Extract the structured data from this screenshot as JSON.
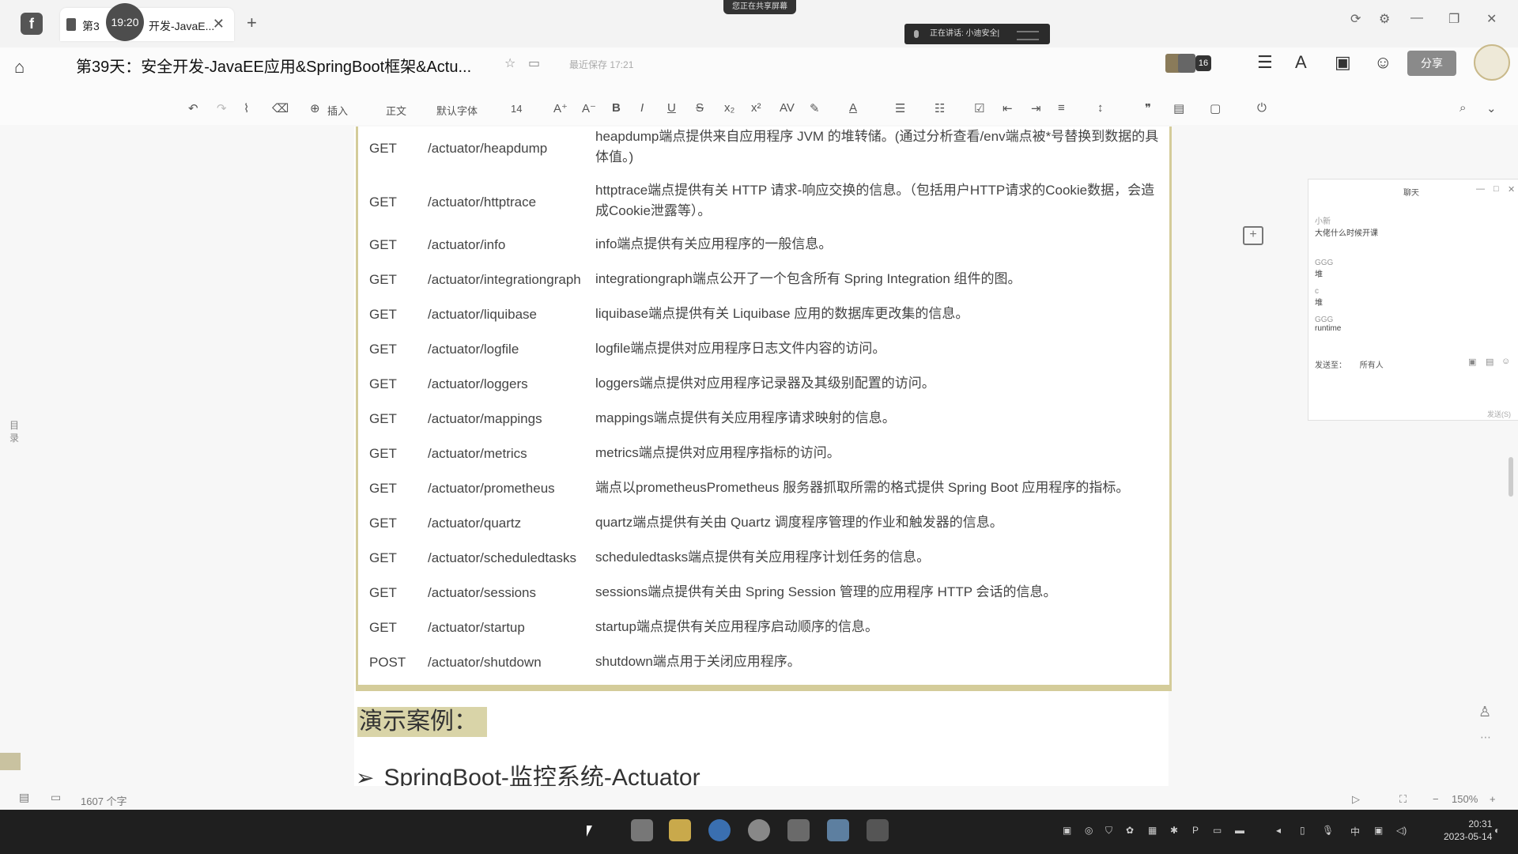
{
  "window": {
    "tab_title_left": "第3",
    "tab_title_right": "开发-JavaE...",
    "tab_close": "✕",
    "new_tab": "+",
    "timer": "19:20",
    "sharing_notice": "您正在共享屏幕",
    "voice_status": "正在讲话: 小迪安全|"
  },
  "header": {
    "doc_title": "第39天：安全开发-JavaEE应用&SpringBoot框架&Actu...",
    "save_status": "最近保存 17:21",
    "collaborators_count": "16",
    "share_label": "分享"
  },
  "toolbar": {
    "insert_label": "插入",
    "style_label": "正文",
    "font_label": "默认字体",
    "size_label": "14"
  },
  "endpoints": [
    {
      "method": "GET",
      "path": "/actuator/heapdump",
      "desc": "heapdump端点提供来自应用程序 JVM 的堆转储。(通过分析查看/env端点被*号替换到数据的具体值。)"
    },
    {
      "method": "GET",
      "path": "/actuator/httptrace",
      "desc": "httptrace端点提供有关 HTTP 请求-响应交换的信息。（包括用户HTTP请求的Cookie数据，会造成Cookie泄露等）。"
    },
    {
      "method": "GET",
      "path": "/actuator/info",
      "desc": "info端点提供有关应用程序的一般信息。"
    },
    {
      "method": "GET",
      "path": "/actuator/integrationgraph",
      "desc": "integrationgraph端点公开了一个包含所有 Spring Integration 组件的图。"
    },
    {
      "method": "GET",
      "path": "/actuator/liquibase",
      "desc": "liquibase端点提供有关 Liquibase 应用的数据库更改集的信息。"
    },
    {
      "method": "GET",
      "path": "/actuator/logfile",
      "desc": "logfile端点提供对应用程序日志文件内容的访问。"
    },
    {
      "method": "GET",
      "path": "/actuator/loggers",
      "desc": "loggers端点提供对应用程序记录器及其级别配置的访问。"
    },
    {
      "method": "GET",
      "path": "/actuator/mappings",
      "desc": "mappings端点提供有关应用程序请求映射的信息。"
    },
    {
      "method": "GET",
      "path": "/actuator/metrics",
      "desc": "metrics端点提供对应用程序指标的访问。"
    },
    {
      "method": "GET",
      "path": "/actuator/prometheus",
      "desc": "端点以prometheusPrometheus 服务器抓取所需的格式提供 Spring Boot 应用程序的指标。"
    },
    {
      "method": "GET",
      "path": "/actuator/quartz",
      "desc": "quartz端点提供有关由 Quartz 调度程序管理的作业和触发器的信息。"
    },
    {
      "method": "GET",
      "path": "/actuator/scheduledtasks",
      "desc": "scheduledtasks端点提供有关应用程序计划任务的信息。"
    },
    {
      "method": "GET",
      "path": "/actuator/sessions",
      "desc": "sessions端点提供有关由 Spring Session 管理的应用程序 HTTP 会话的信息。"
    },
    {
      "method": "GET",
      "path": "/actuator/startup",
      "desc": "startup端点提供有关应用程序启动顺序的信息。"
    },
    {
      "method": "POST",
      "path": "/actuator/shutdown",
      "desc": "shutdown端点用于关闭应用程序。"
    }
  ],
  "content": {
    "demo_heading": "演示案例：",
    "section_title": "SpringBoot-监控系统-Actuator",
    "toc_label": "目录"
  },
  "chat": {
    "title": "聊天",
    "messages": [
      {
        "name": "小新",
        "text": "大佬什么时候开课"
      },
      {
        "name": "GGG",
        "text": "堆"
      },
      {
        "name": "c",
        "text": "堆"
      },
      {
        "name": "GGG",
        "text": "runtime"
      }
    ],
    "send_to_label": "发送至：",
    "send_to_value": "所有人",
    "send_button": "发送(S)"
  },
  "statusbar": {
    "word_count": "1607 个字",
    "zoom": "150%"
  },
  "clock": {
    "time": "20:31",
    "date": "2023-05-14"
  },
  "tray": {
    "ime": "中"
  },
  "colors": {
    "table_border": "#d4cc9a",
    "highlight": "#d9d4a8",
    "taskbar": "#1f1f1f"
  }
}
